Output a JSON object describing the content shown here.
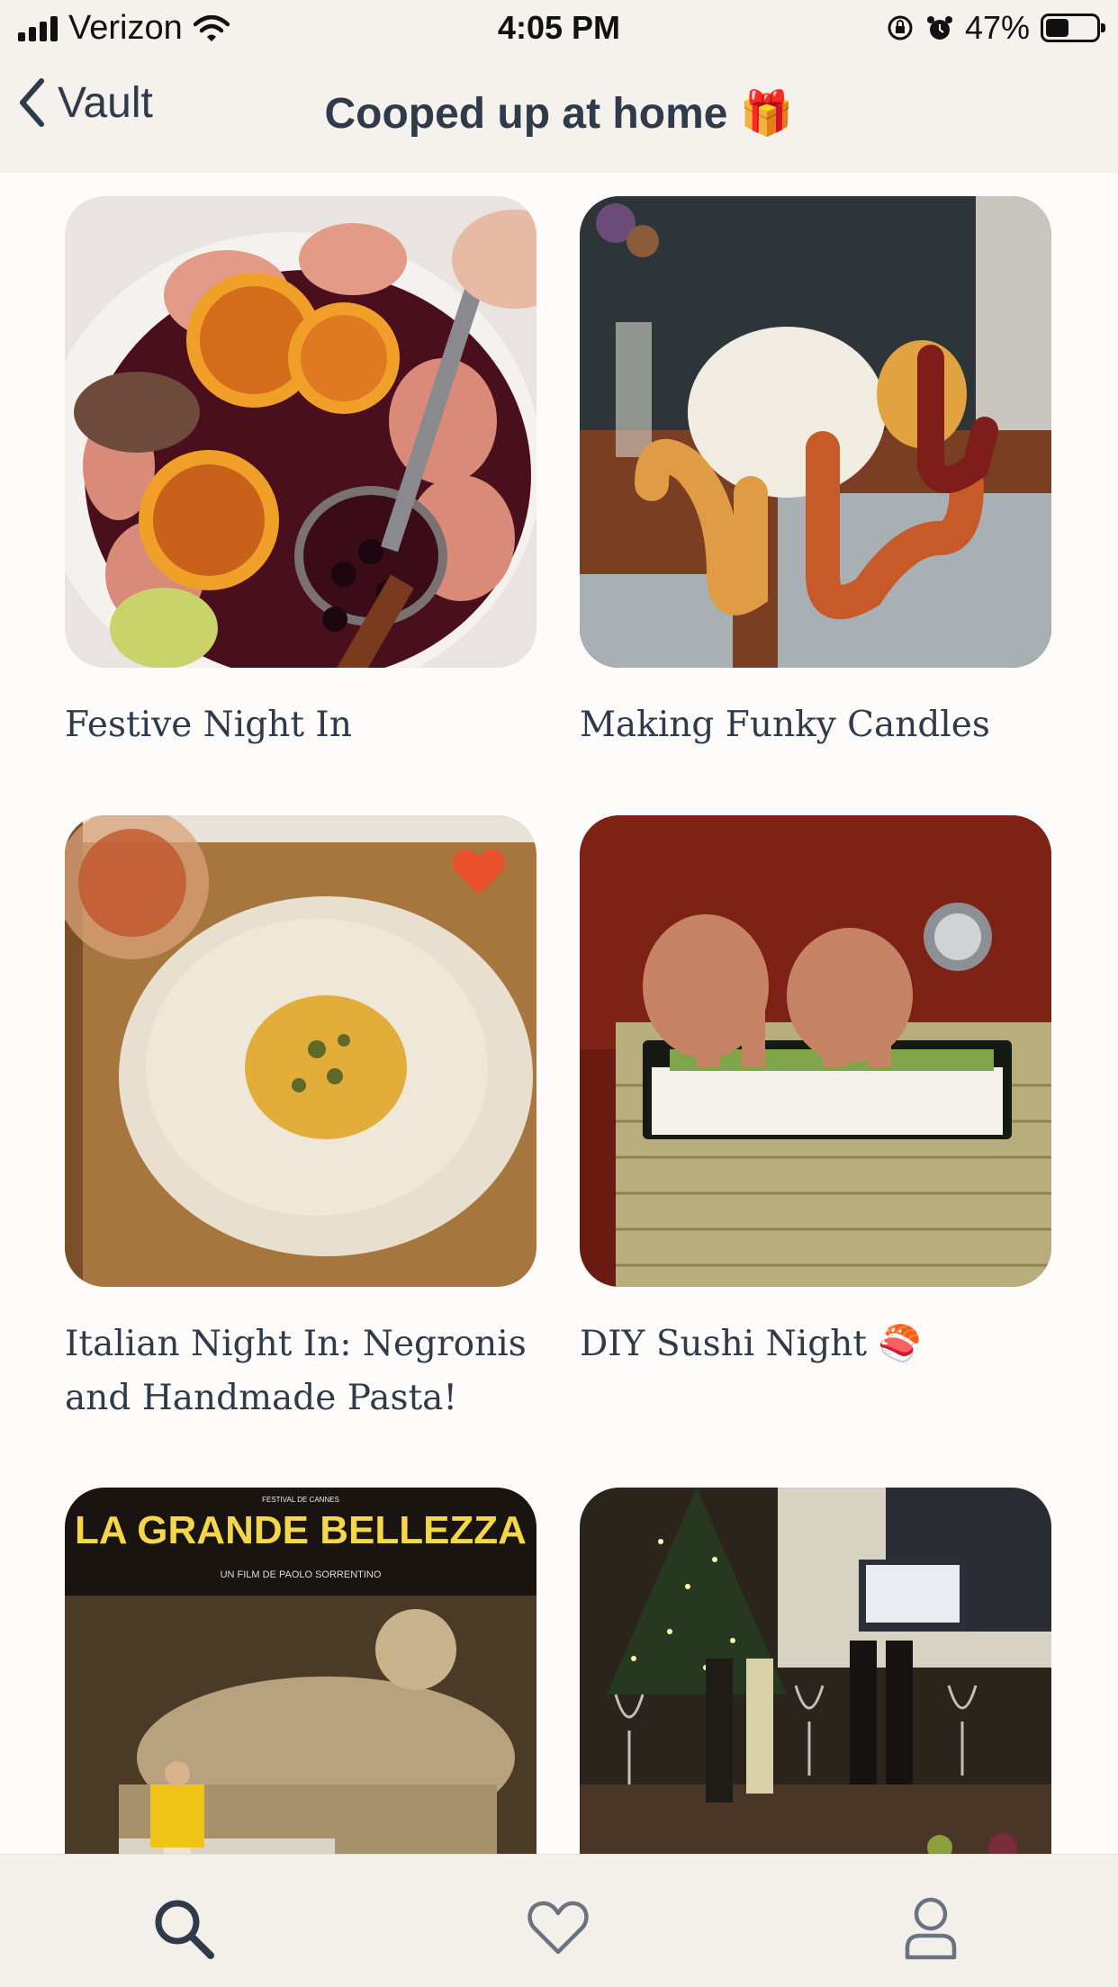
{
  "status_bar": {
    "carrier": "Verizon",
    "time": "4:05 PM",
    "battery_pct": "47%",
    "battery_level": 0.47
  },
  "nav": {
    "back_label": "Vault",
    "title": "Cooped up at home 🎁"
  },
  "cards": [
    {
      "title": "Festive Night In",
      "favorited": false
    },
    {
      "title": "Making Funky Candles",
      "favorited": false
    },
    {
      "title": "Italian Night In: Negronis and Handmade Pasta!",
      "favorited": true
    },
    {
      "title": "DIY Sushi Night 🍣",
      "favorited": false
    },
    {
      "poster_title": "LA GRANDE BELLEZZA",
      "poster_festival": "FESTIVAL DE CANNES",
      "poster_credit": "UN FILM DE\nPAOLO SORRENTINO"
    },
    {
      "title": ""
    }
  ],
  "tabs": [
    {
      "name": "search",
      "icon": "search-icon"
    },
    {
      "name": "favorites",
      "icon": "heart-icon"
    },
    {
      "name": "profile",
      "icon": "user-icon"
    }
  ],
  "colors": {
    "accent": "#2f3a4a",
    "favorite": "#e9502b",
    "header_bg": "#f5f1ed"
  }
}
